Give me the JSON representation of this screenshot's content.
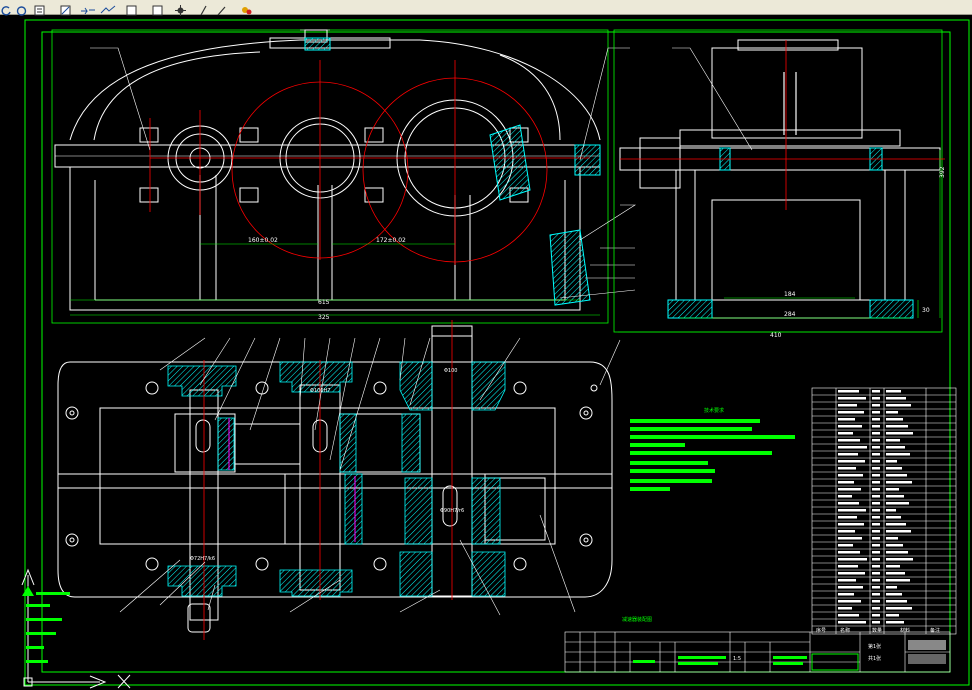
{
  "app": {
    "title": ""
  },
  "toolbar": {
    "buttons": [
      {
        "icon": "undo-icon"
      },
      {
        "icon": "redo-icon"
      },
      {
        "icon": "properties-icon"
      },
      {
        "icon": "match-properties-icon"
      },
      {
        "icon": "pan-icon"
      },
      {
        "icon": "zoom-window-icon"
      },
      {
        "icon": "zoom-previous-icon"
      },
      {
        "icon": "tool-palette-icon"
      },
      {
        "icon": "design-center-icon"
      },
      {
        "icon": "markup-icon"
      },
      {
        "icon": "calculator-icon"
      }
    ]
  },
  "drawing": {
    "dimensions": {
      "front_span_1": "160±0.02",
      "front_span_2": "172±0.02",
      "front_width": "615",
      "front_height": "325",
      "side_inner": "184",
      "side_base": "284",
      "side_total": "410",
      "side_height": "392",
      "side_foot": "30",
      "plan_shaft_1": "Φ72H7/k6",
      "plan_shaft_2": "Φ100H7",
      "plan_bearing": "Φ100",
      "plan_key": "Φ90H7/r6"
    },
    "tech_title": "技术要求",
    "drawing_name": "减速器装配图",
    "scale_row": [
      "1:5",
      "第1张",
      "共1张"
    ],
    "bom_footer": [
      "序号",
      "名称",
      "数量",
      "材料",
      "备注"
    ]
  },
  "colors": {
    "background": "#000000",
    "outline": "#ffffff",
    "frame": "#00ff00",
    "centerline": "#ff0000",
    "hatch": "#00ffff",
    "dimension": "#00ff00",
    "text_block": "#00ff00"
  }
}
